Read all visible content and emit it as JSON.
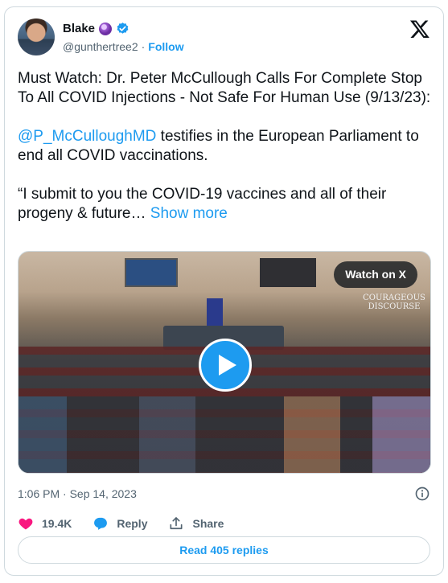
{
  "author": {
    "name": "Blake",
    "handle": "@gunthertree2",
    "separator": "·",
    "follow_label": "Follow"
  },
  "tweet": {
    "line1": "Must Watch: Dr. Peter McCullough Calls For Complete Stop To All COVID Injections - Not Safe For Human Use (9/13/23):",
    "mention": "@P_McCulloughMD",
    "line2_rest": " testifies in the European Parliament to end all COVID vaccinations.",
    "quote": "“I submit to you the COVID-19 vaccines and all of their progeny & future… ",
    "show_more": "Show more"
  },
  "media": {
    "watch_label": "Watch on X",
    "watermark_line1": "COURAGEOUS",
    "watermark_line2": "DISCOURSE"
  },
  "meta": {
    "timestamp": "1:06 PM · Sep 14, 2023"
  },
  "actions": {
    "likes": "19.4K",
    "reply_label": "Reply",
    "share_label": "Share"
  },
  "read_replies": "Read 405 replies",
  "colors": {
    "accent": "#1d9bf0",
    "like": "#f91880",
    "text": "#0f1419",
    "muted": "#536471"
  }
}
